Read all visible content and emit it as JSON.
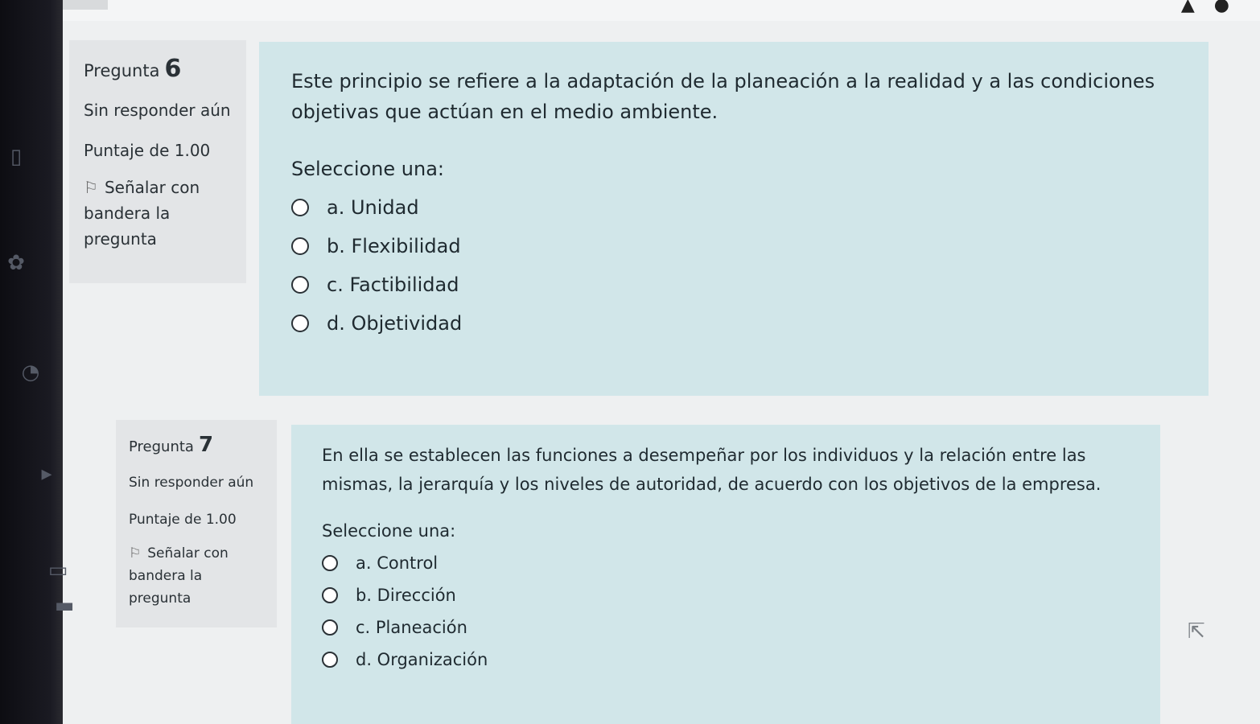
{
  "sidebar": {
    "icons": [
      "book-icon",
      "flower-icon",
      "clock-icon",
      "play-icon",
      "photo-icon",
      "card-icon"
    ]
  },
  "questions": [
    {
      "label": "Pregunta",
      "number": "6",
      "status": "Sin responder aún",
      "score": "Puntaje de 1.00",
      "flag_label": "Señalar con bandera la pregunta",
      "text": "Este principio se refiere a la adaptación de la planeación a la realidad y a las condiciones objetivas que actúan en el medio ambiente.",
      "prompt": "Seleccione una:",
      "options": [
        "a. Unidad",
        "b. Flexibilidad",
        "c. Factibilidad",
        "d. Objetividad"
      ]
    },
    {
      "label": "Pregunta",
      "number": "7",
      "status": "Sin responder aún",
      "score": "Puntaje de 1.00",
      "flag_label": "Señalar con bandera la pregunta",
      "text": "En ella se establecen las funciones a desempeñar por los individuos y la relación entre las mismas, la jerarquía y los niveles de autoridad, de acuerdo con los objetivos de la empresa.",
      "prompt": "Seleccione una:",
      "options": [
        "a. Control",
        "b. Dirección",
        "c. Planeación",
        "d. Organización"
      ]
    }
  ],
  "colors": {
    "content_bg": "#d1e6e9",
    "info_bg": "#e3e5e7",
    "sidebar_bg": "#0d0d12"
  }
}
